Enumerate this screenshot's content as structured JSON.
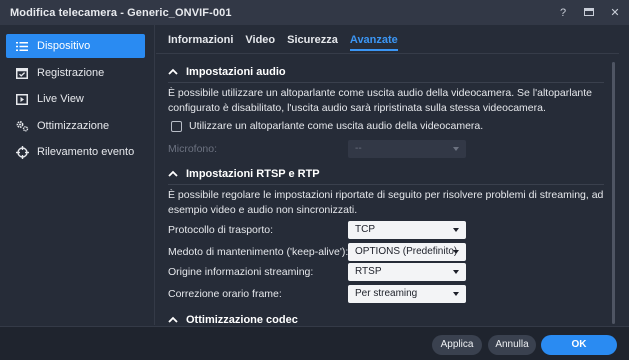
{
  "window": {
    "title": "Modifica telecamera - Generic_ONVIF-001",
    "controls": {
      "help": "?",
      "close": "✕"
    }
  },
  "sidebar": {
    "items": [
      {
        "label": "Dispositivo",
        "icon": "list-icon",
        "active": true
      },
      {
        "label": "Registrazione",
        "icon": "calendar-icon",
        "active": false
      },
      {
        "label": "Live View",
        "icon": "play-icon",
        "active": false
      },
      {
        "label": "Ottimizzazione",
        "icon": "gears-icon",
        "active": false
      },
      {
        "label": "Rilevamento evento",
        "icon": "crosshair-icon",
        "active": false
      }
    ]
  },
  "tabs": [
    {
      "label": "Informazioni",
      "active": false
    },
    {
      "label": "Video",
      "active": false
    },
    {
      "label": "Sicurezza",
      "active": false
    },
    {
      "label": "Avanzate",
      "active": true
    }
  ],
  "audio": {
    "title": "Impostazioni audio",
    "description": "È possibile utilizzare un altoparlante come uscita audio della videocamera. Se l'altoparlante configurato è disabilitato, l'uscita audio sarà ripristinata sulla stessa videocamera.",
    "checkbox_label": "Utilizzare un altoparlante come uscita audio della videocamera.",
    "checked": false,
    "mic_label": "Microfono:",
    "mic_value": "--"
  },
  "rtsp": {
    "title": "Impostazioni RTSP e RTP",
    "description": "È possibile regolare le impostazioni riportate di seguito per risolvere problemi di streaming, ad esempio video e audio non sincronizzati.",
    "rows": [
      {
        "label": "Protocollo di trasporto:",
        "value": "TCP"
      },
      {
        "label": "Medoto di mantenimento ('keep-alive'):",
        "value": "OPTIONS (Predefinito)"
      },
      {
        "label": "Origine informazioni streaming:",
        "value": "RTSP"
      },
      {
        "label": "Correzione orario frame:",
        "value": "Per streaming"
      }
    ]
  },
  "codec": {
    "title": "Ottimizzazione codec"
  },
  "footer": {
    "apply": "Applica",
    "cancel": "Annulla",
    "ok": "OK"
  },
  "colors": {
    "accent": "#2a8bf2",
    "background": "#262c38",
    "footer": "#1f242e"
  }
}
